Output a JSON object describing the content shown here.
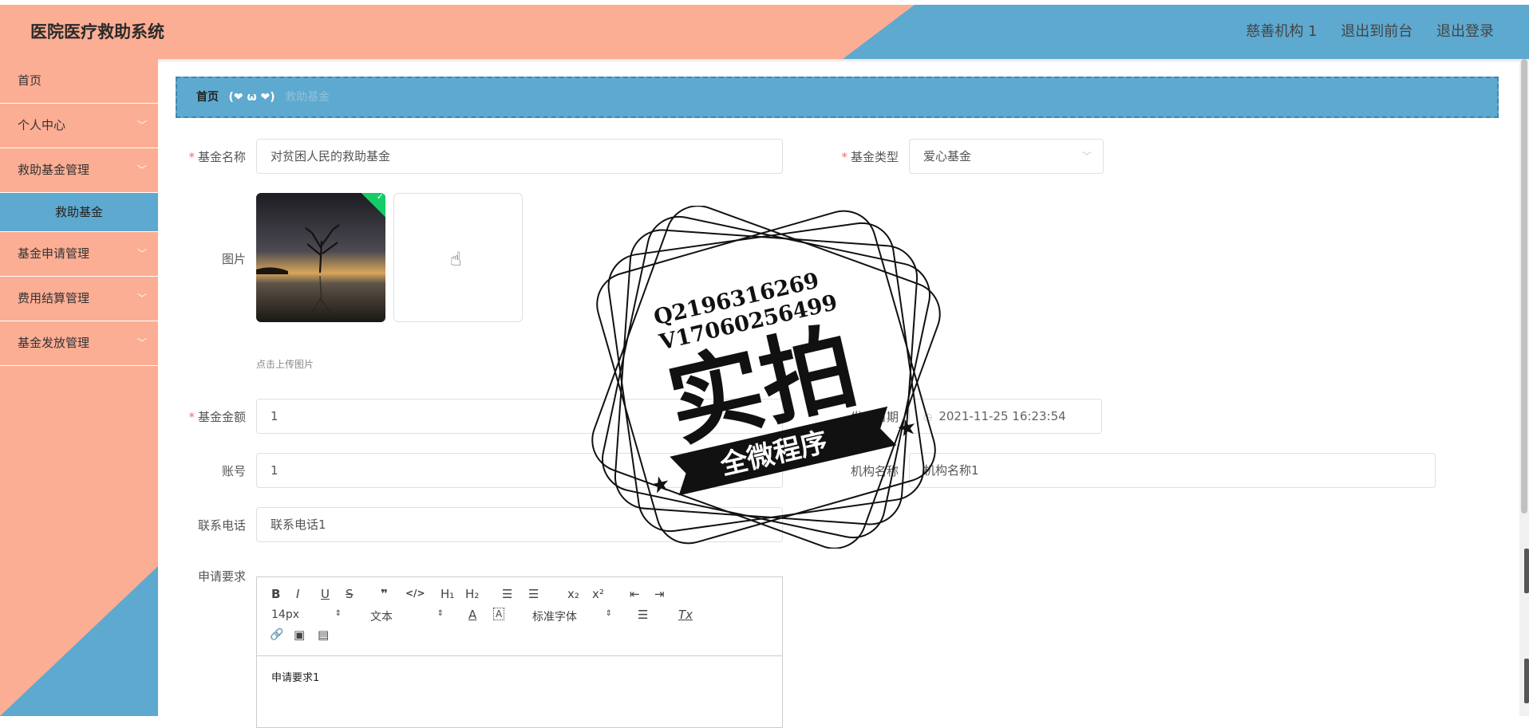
{
  "header": {
    "title": "医院医疗救助系统",
    "links": [
      "慈善机构 1",
      "退出到前台",
      "退出登录"
    ]
  },
  "sidebar": {
    "items": [
      {
        "label": "首页"
      },
      {
        "label": "个人中心"
      },
      {
        "label": "救助基金管理"
      },
      {
        "label": "救助基金"
      },
      {
        "label": "基金申请管理"
      },
      {
        "label": "费用结算管理"
      },
      {
        "label": "基金发放管理"
      }
    ]
  },
  "breadcrumb": {
    "home": "首页",
    "separator": "(❤ ω ❤)",
    "current": "救助基金"
  },
  "form": {
    "fund_name": {
      "label": "基金名称",
      "value": "对贫困人民的救助基金"
    },
    "fund_type": {
      "label": "基金类型",
      "value": "爱心基金"
    },
    "image": {
      "label": "图片",
      "tip": "点击上传图片"
    },
    "amount": {
      "label": "基金金额",
      "value": "1"
    },
    "publish_date": {
      "label": "发布日期",
      "value": "2021-11-25 16:23:54"
    },
    "account": {
      "label": "账号",
      "value": "1"
    },
    "org_name": {
      "label": "机构名称",
      "value": "机构名称1"
    },
    "phone": {
      "label": "联系电话",
      "value": "联系电话1"
    },
    "requirements": {
      "label": "申请要求",
      "value": "申请要求1"
    }
  },
  "editor": {
    "font_size": "14px",
    "header_select": "文本",
    "font_family": "标准字体",
    "buttons": {
      "bold": "B",
      "italic": "I",
      "underline": "U",
      "strike": "S",
      "quote": "❞",
      "code": "</>",
      "h1": "H₁",
      "h2": "H₂",
      "ol": "☰",
      "ul": "☰",
      "sub": "x₂",
      "sup": "x²",
      "outdent": "⇤",
      "indent": "⇥",
      "color": "A",
      "background": "A",
      "align": "☰",
      "clean": "Tx",
      "link": "🔗",
      "image": "▣",
      "video": "▤"
    }
  },
  "watermark": {
    "line1": "Q2196316269",
    "line2": "V17060256499",
    "big": "实拍",
    "banner": "全微程序"
  },
  "colors": {
    "peach": "#fcae94",
    "blue": "#5ea9cf",
    "required": "#f56c6c",
    "success": "#13ce66"
  }
}
